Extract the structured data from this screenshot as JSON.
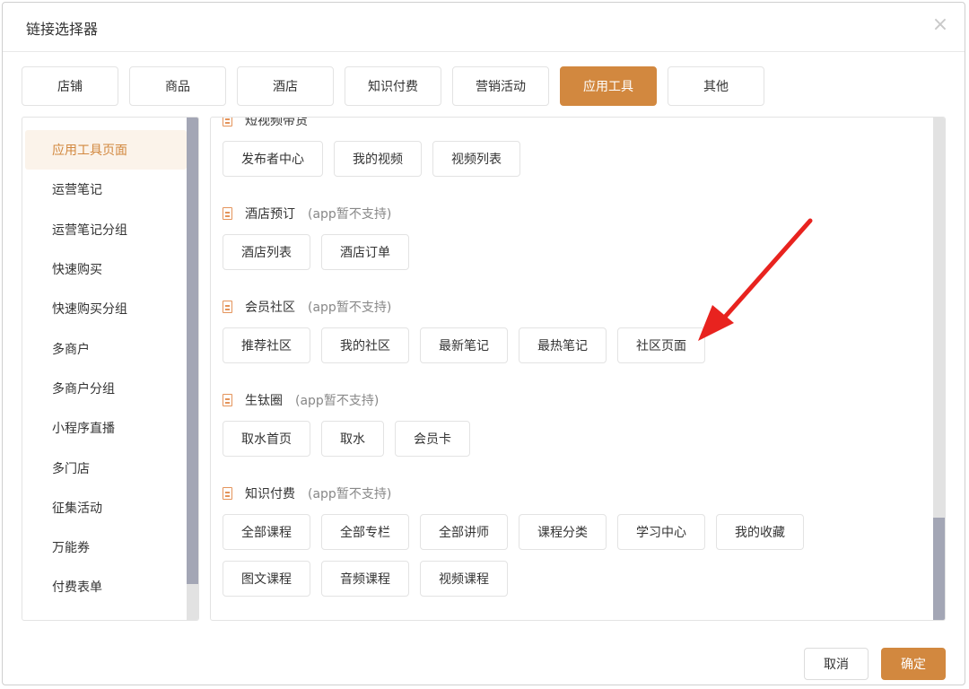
{
  "dialog": {
    "title": "链接选择器",
    "close_icon": "×"
  },
  "tabs": [
    {
      "label": "店铺"
    },
    {
      "label": "商品"
    },
    {
      "label": "酒店"
    },
    {
      "label": "知识付费"
    },
    {
      "label": "营销活动"
    },
    {
      "label": "应用工具",
      "active": true
    },
    {
      "label": "其他"
    }
  ],
  "sidebar": {
    "items": [
      {
        "label": "应用工具页面",
        "active": true
      },
      {
        "label": "运营笔记"
      },
      {
        "label": "运营笔记分组"
      },
      {
        "label": "快速购买"
      },
      {
        "label": "快速购买分组"
      },
      {
        "label": "多商户"
      },
      {
        "label": "多商户分组"
      },
      {
        "label": "小程序直播"
      },
      {
        "label": "多门店"
      },
      {
        "label": "征集活动"
      },
      {
        "label": "万能券"
      },
      {
        "label": "付费表单"
      }
    ]
  },
  "sections": [
    {
      "name": "短视频带货",
      "note": "",
      "rows": [
        [
          "发布者中心",
          "我的视频",
          "视频列表"
        ]
      ]
    },
    {
      "name": "酒店预订",
      "note": "(app暂不支持)",
      "rows": [
        [
          "酒店列表",
          "酒店订单"
        ]
      ]
    },
    {
      "name": "会员社区",
      "note": "(app暂不支持)",
      "rows": [
        [
          "推荐社区",
          "我的社区",
          "最新笔记",
          "最热笔记",
          "社区页面"
        ]
      ]
    },
    {
      "name": "生钛圈",
      "note": "(app暂不支持)",
      "rows": [
        [
          "取水首页",
          "取水",
          "会员卡"
        ]
      ]
    },
    {
      "name": "知识付费",
      "note": "(app暂不支持)",
      "rows": [
        [
          "全部课程",
          "全部专栏",
          "全部讲师",
          "课程分类",
          "学习中心",
          "我的收藏"
        ],
        [
          "图文课程",
          "音频课程",
          "视频课程"
        ]
      ]
    }
  ],
  "footer": {
    "cancel_label": "取消",
    "confirm_label": "确定"
  },
  "colors": {
    "accent": "#d2883f",
    "arrow": "#e8231f"
  }
}
